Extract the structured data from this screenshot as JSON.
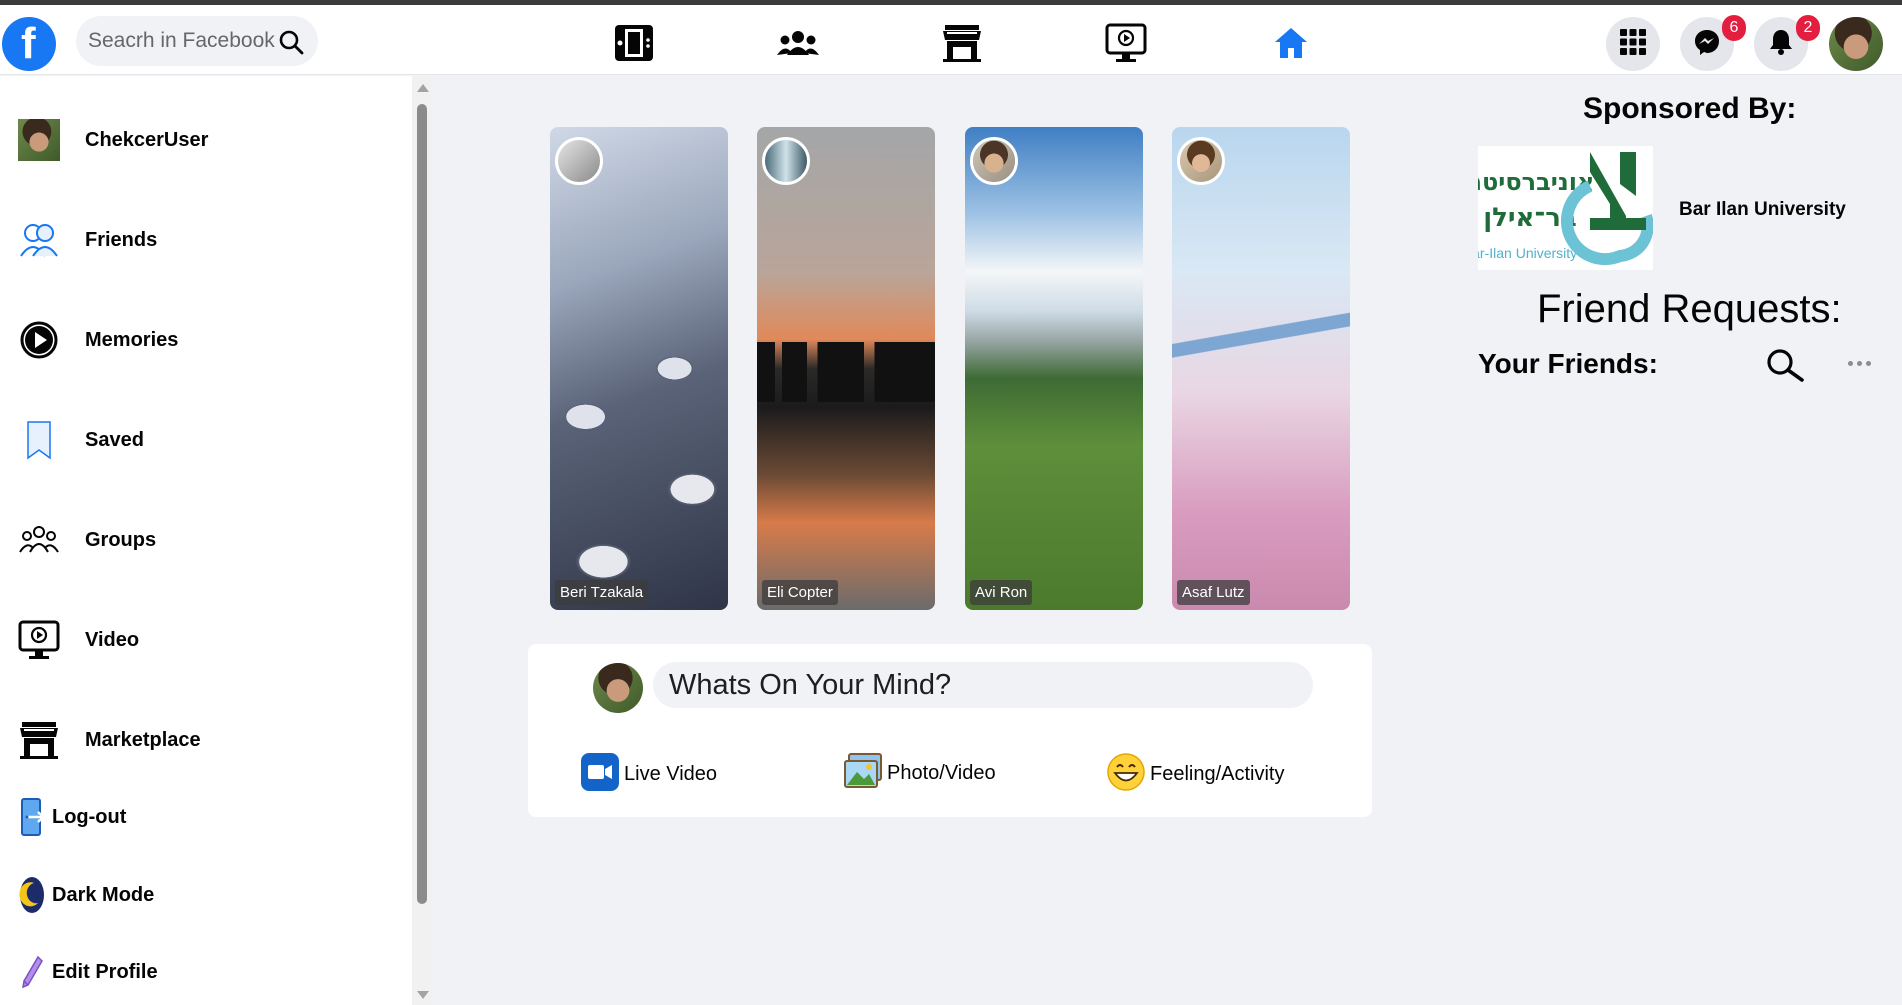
{
  "header": {
    "logo_letter": "f",
    "search_placeholder": "Seacrh in Facebook",
    "nav_icons": [
      "gaming-icon",
      "groups-icon",
      "marketplace-icon",
      "watch-icon",
      "home-icon"
    ],
    "messenger_badge": "6",
    "notifications_badge": "2",
    "accent_color": "#1877f2",
    "badge_color": "#e41e3f"
  },
  "sidebar": {
    "items": [
      {
        "label": "ChekcerUser",
        "icon": "avatar"
      },
      {
        "label": "Friends",
        "icon": "friends-icon"
      },
      {
        "label": "Memories",
        "icon": "memories-icon"
      },
      {
        "label": "Saved",
        "icon": "bookmark-icon"
      },
      {
        "label": "Groups",
        "icon": "groups-icon"
      },
      {
        "label": "Video",
        "icon": "video-icon"
      },
      {
        "label": "Marketplace",
        "icon": "marketplace-icon"
      },
      {
        "label": "Log-out",
        "icon": "logout-icon"
      },
      {
        "label": "Dark Mode",
        "icon": "moon-icon"
      },
      {
        "label": "Edit Profile",
        "icon": "pencil-icon"
      }
    ]
  },
  "stories": [
    {
      "name": "Beri Tzakala"
    },
    {
      "name": "Eli Copter"
    },
    {
      "name": "Avi Ron"
    },
    {
      "name": "Asaf Lutz"
    }
  ],
  "composer": {
    "placeholder": "Whats On Your Mind?",
    "actions": [
      {
        "label": "Live Video",
        "icon": "live-video-icon"
      },
      {
        "label": "Photo/Video",
        "icon": "photo-icon"
      },
      {
        "label": "Feeling/Activity",
        "icon": "smile-icon"
      }
    ]
  },
  "right": {
    "sponsored_title": "Sponsored By:",
    "sponsor_name": "Bar Ilan University",
    "sponsor_logo_text_he_1": "אוניברסיטת",
    "sponsor_logo_text_he_2": "בר־אילן",
    "sponsor_logo_text_en": "Bar-Ilan University",
    "friend_requests_title": "Friend Requests:",
    "your_friends_title": "Your Friends:"
  }
}
